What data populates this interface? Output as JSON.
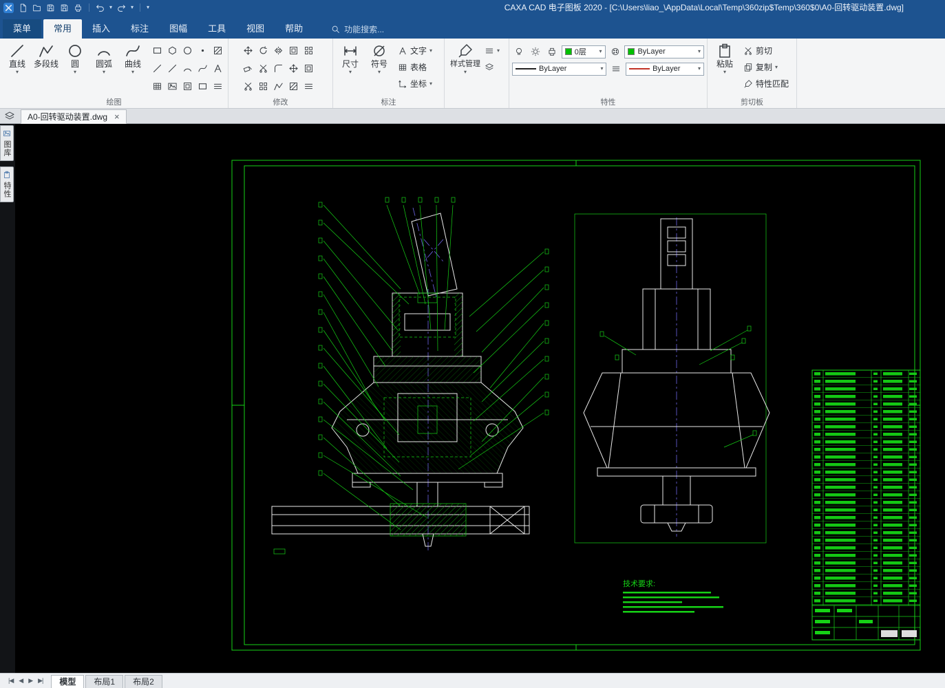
{
  "window": {
    "title": "CAXA CAD 电子图板 2020 - [C:\\Users\\liao_\\AppData\\Local\\Temp\\360zip$Temp\\360$0\\A0-回转驱动装置.dwg]"
  },
  "ribbon_tabs": [
    {
      "label": "菜单"
    },
    {
      "label": "常用"
    },
    {
      "label": "插入"
    },
    {
      "label": "标注"
    },
    {
      "label": "图幅"
    },
    {
      "label": "工具"
    },
    {
      "label": "视图"
    },
    {
      "label": "帮助"
    }
  ],
  "search": {
    "label": "功能搜索..."
  },
  "groups": {
    "draw": {
      "label": "绘图",
      "tools": [
        {
          "label": "直线"
        },
        {
          "label": "多段线"
        },
        {
          "label": "圆"
        },
        {
          "label": "圆弧"
        },
        {
          "label": "曲线"
        }
      ]
    },
    "modify": {
      "label": "修改"
    },
    "annotate": {
      "label": "标注",
      "dim": "尺寸",
      "symbol": "符号",
      "text": "文字",
      "table": "表格",
      "coord": "坐标"
    },
    "style": {
      "label": "样式管理"
    },
    "props": {
      "label": "特性",
      "layer": "0层",
      "color": "ByLayer",
      "linetype": "ByLayer",
      "lineweight": "ByLayer"
    },
    "clip": {
      "label": "剪切板",
      "paste": "粘贴",
      "cut": "剪切",
      "copy": "复制",
      "match": "特性匹配"
    }
  },
  "doc_tab": {
    "label": "A0-回转驱动装置.dwg",
    "close": "×"
  },
  "side_tabs": [
    {
      "label": "图库"
    },
    {
      "label": "特性"
    }
  ],
  "drawing": {
    "tech_req": "技术要求:"
  },
  "sheet_bar": {
    "first": "|◀",
    "prev": "◀",
    "next": "▶",
    "last": "▶|",
    "tabs": [
      {
        "label": "模型"
      },
      {
        "label": "布局1"
      },
      {
        "label": "布局2"
      }
    ]
  },
  "glyphs": {
    "dropdown": "▾"
  },
  "colors": {
    "titlebar": "#1d5390",
    "ribbon_bg": "#f4f5f6",
    "canvas_bg": "#000000",
    "cad_green": "#16d216",
    "cad_white": "#e9e9e9",
    "centerline_blue": "#6f66e8",
    "layer_swatch_green": "#00c000",
    "lineweight_red": "#c23226"
  }
}
